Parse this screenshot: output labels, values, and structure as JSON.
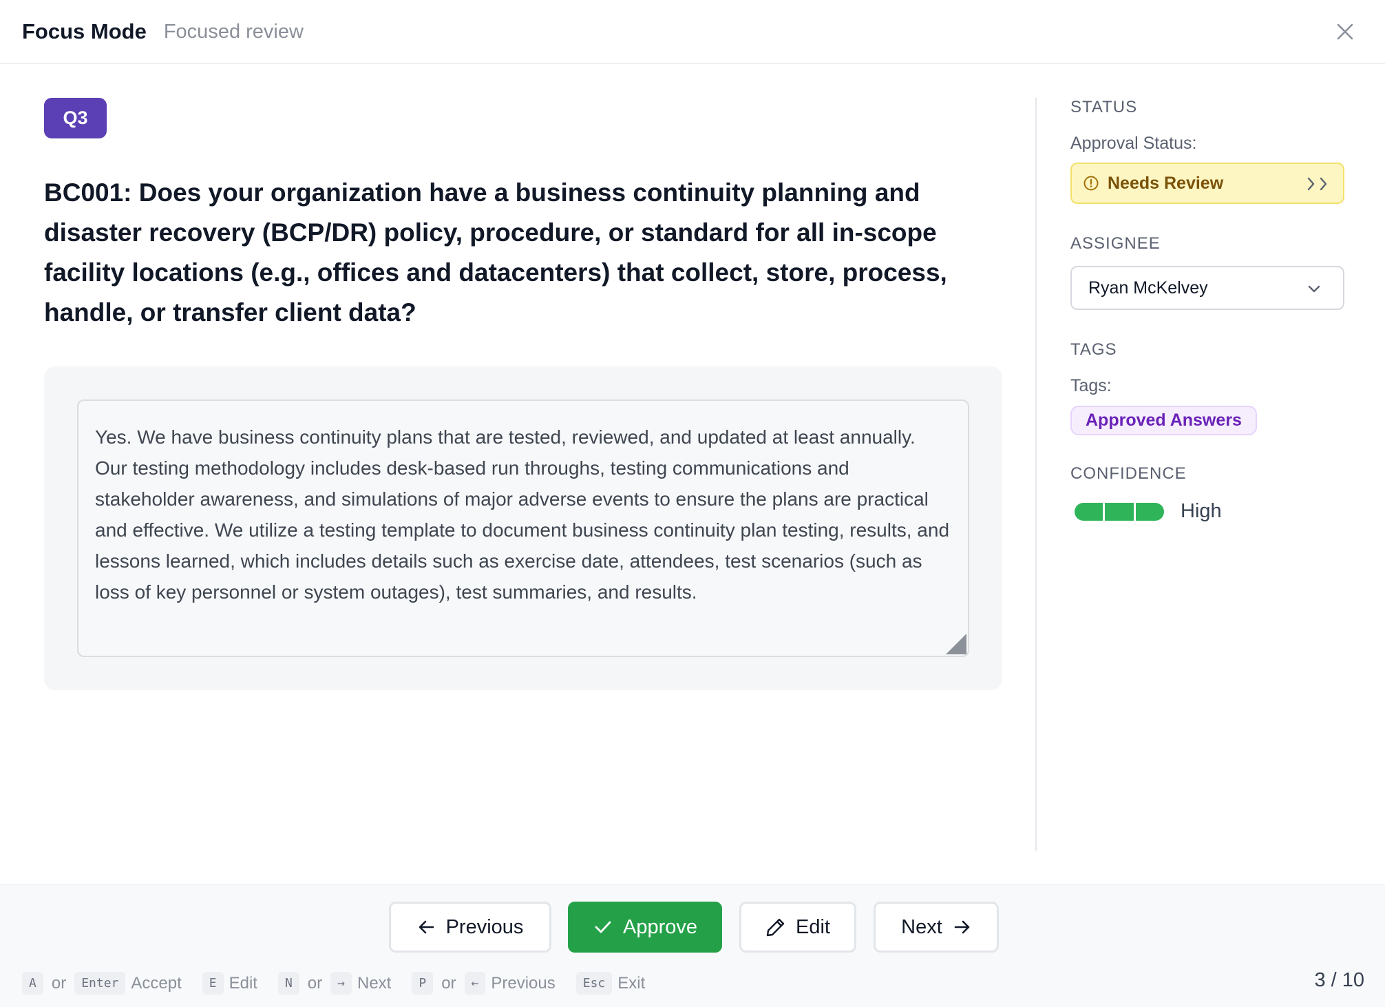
{
  "header": {
    "title": "Focus Mode",
    "subtitle": "Focused review"
  },
  "question": {
    "badge": "Q3",
    "text": "BC001: Does your organization have a business continuity planning and disaster recovery (BCP/DR) policy, procedure, or standard for all in-scope facility locations (e.g., offices and datacenters) that collect, store, process, handle, or transfer client data?",
    "answer": "Yes. We have business continuity plans that are tested, reviewed, and updated at least annually. Our testing methodology includes desk-based run throughs, testing communications and stakeholder awareness, and simulations of major adverse events to ensure the plans are practical and effective. We utilize a testing template to document business continuity plan testing, results, and lessons learned, which includes details such as exercise date, attendees, test scenarios (such as loss of key personnel or system outages), test summaries, and results."
  },
  "sidebar": {
    "status": {
      "section_title": "STATUS",
      "label": "Approval Status:",
      "value": "Needs Review",
      "color": "#fdf6c3"
    },
    "assignee": {
      "section_title": "ASSIGNEE",
      "value": "Ryan McKelvey"
    },
    "tags": {
      "section_title": "TAGS",
      "label": "Tags:",
      "items": [
        "Approved Answers"
      ]
    },
    "confidence": {
      "section_title": "CONFIDENCE",
      "level": "High",
      "segments_filled": 3,
      "segments_total": 3,
      "color": "#2fb45a"
    }
  },
  "footer": {
    "buttons": {
      "previous": "Previous",
      "approve": "Approve",
      "edit": "Edit",
      "next": "Next"
    },
    "shortcuts": {
      "accept_key_a": "A",
      "or": "or",
      "accept_key_enter": "Enter",
      "accept_label": "Accept",
      "edit_key": "E",
      "edit_label": "Edit",
      "next_key_n": "N",
      "next_key_arrow": "→",
      "next_label": "Next",
      "prev_key_p": "P",
      "prev_key_arrow": "←",
      "prev_label": "Previous",
      "exit_key": "Esc",
      "exit_label": "Exit"
    },
    "pager": "3 / 10"
  }
}
